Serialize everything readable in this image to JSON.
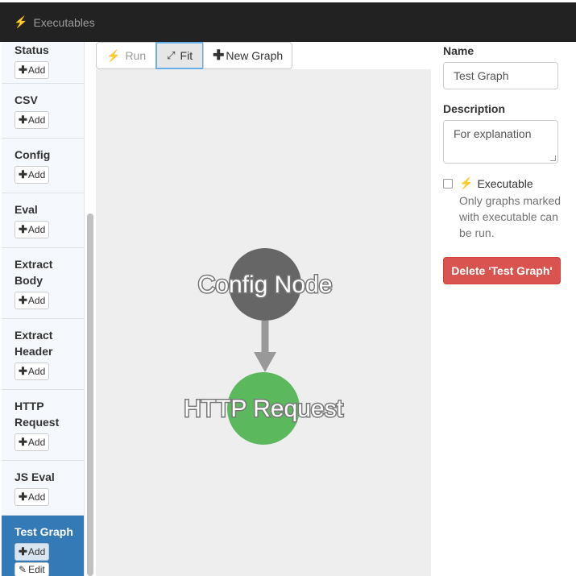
{
  "header": {
    "icon": "bolt-icon",
    "title": "Executables"
  },
  "sidebar": {
    "add_label": "Add",
    "edit_label": "Edit",
    "items": [
      {
        "label": "Status"
      },
      {
        "label": "CSV"
      },
      {
        "label": "Config"
      },
      {
        "label": "Eval"
      },
      {
        "label": "Extract Body"
      },
      {
        "label": "Extract Header"
      },
      {
        "label": "HTTP Request"
      },
      {
        "label": "JS Eval"
      },
      {
        "label": "Test Graph",
        "active": true
      }
    ]
  },
  "toolbar": {
    "run_label": "Run",
    "fit_label": "Fit",
    "new_graph_label": "New Graph"
  },
  "graph": {
    "nodes": [
      {
        "label": "Config Node",
        "color": "#666666"
      },
      {
        "label": "HTTP Request",
        "color": "#5cb85c"
      }
    ],
    "edge_color": "#999999"
  },
  "panel": {
    "name_label": "Name",
    "name_value": "Test Graph",
    "description_label": "Description",
    "description_value": "For explanation",
    "executable_label": "Executable",
    "executable_checked": false,
    "help_text": "Only graphs marked with executable can be run.",
    "delete_label": "Delete 'Test Graph'"
  },
  "colors": {
    "navbar": "#222222",
    "active_item": "#337ab7",
    "danger": "#d9534f",
    "accent": "#f0ad4e"
  }
}
